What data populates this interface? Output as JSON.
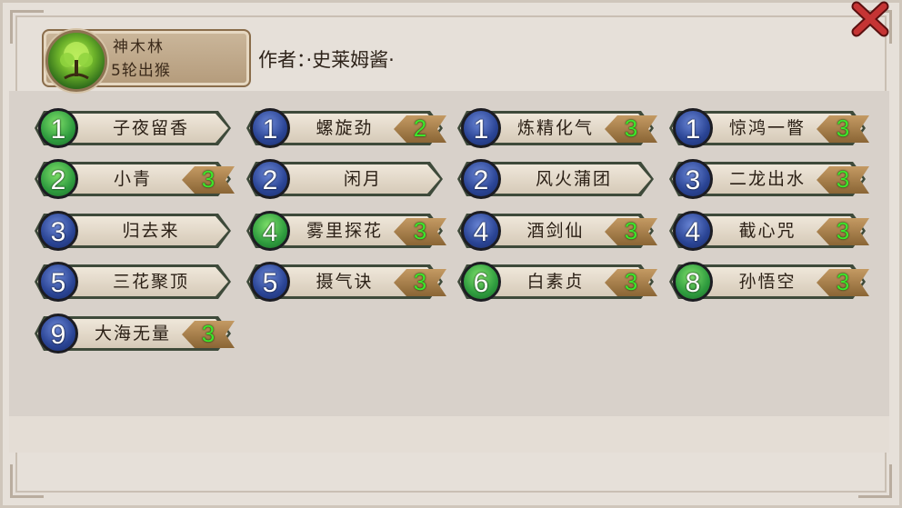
{
  "level": {
    "name": "神木林",
    "subtitle": "5轮出猴",
    "icon": "tree-orb-icon"
  },
  "author_line": "作者：·史莱姆酱·",
  "close_icon": "close-x-icon",
  "colors": {
    "blue_badge": "#2a4494",
    "green_badge": "#2e9b3e",
    "star_text": "#3fe52a",
    "close_x": "#b02a2a"
  },
  "cards": [
    {
      "num": "1",
      "badge": "green",
      "name": "子夜留香",
      "star": ""
    },
    {
      "num": "1",
      "badge": "blue",
      "name": "螺旋劲",
      "star": "2"
    },
    {
      "num": "1",
      "badge": "blue",
      "name": "炼精化气",
      "star": "3"
    },
    {
      "num": "1",
      "badge": "blue",
      "name": "惊鸿一瞥",
      "star": "3"
    },
    {
      "num": "2",
      "badge": "green",
      "name": "小青",
      "star": "3"
    },
    {
      "num": "2",
      "badge": "blue",
      "name": "闲月",
      "star": ""
    },
    {
      "num": "2",
      "badge": "blue",
      "name": "风火蒲团",
      "star": ""
    },
    {
      "num": "3",
      "badge": "blue",
      "name": "二龙出水",
      "star": "3"
    },
    {
      "num": "3",
      "badge": "blue",
      "name": "归去来",
      "star": ""
    },
    {
      "num": "4",
      "badge": "green",
      "name": "雾里探花",
      "star": "3"
    },
    {
      "num": "4",
      "badge": "blue",
      "name": "酒剑仙",
      "star": "3"
    },
    {
      "num": "4",
      "badge": "blue",
      "name": "截心咒",
      "star": "3"
    },
    {
      "num": "5",
      "badge": "blue",
      "name": "三花聚顶",
      "star": ""
    },
    {
      "num": "5",
      "badge": "blue",
      "name": "摄气诀",
      "star": "3"
    },
    {
      "num": "6",
      "badge": "green",
      "name": "白素贞",
      "star": "3"
    },
    {
      "num": "8",
      "badge": "green",
      "name": "孙悟空",
      "star": "3"
    },
    {
      "num": "9",
      "badge": "blue",
      "name": "大海无量",
      "star": "3"
    }
  ]
}
